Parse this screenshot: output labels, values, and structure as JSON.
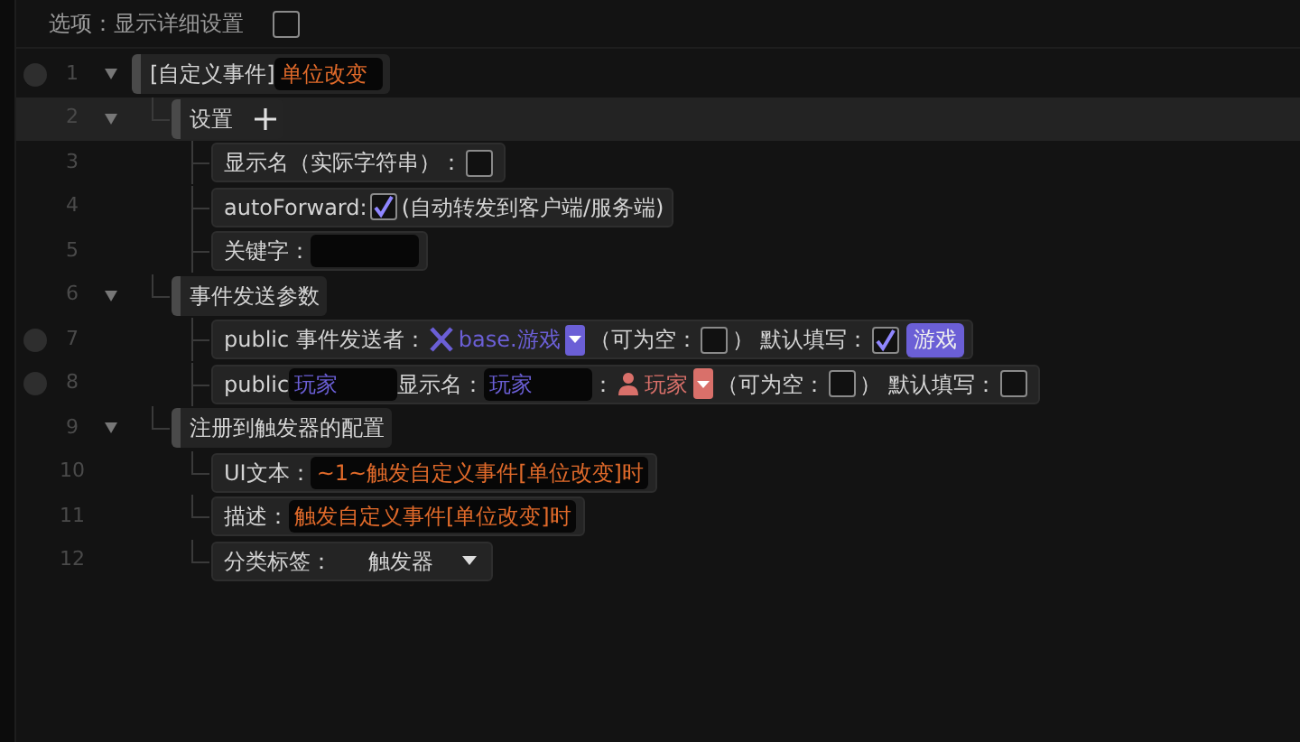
{
  "options": {
    "label": "选项：显示详细设置",
    "checked": false
  },
  "tree": [
    {
      "number": "1",
      "breakpoint": true,
      "expanded": true,
      "selected": false,
      "parts": [
        {
          "kind": "text",
          "text": "[自定义事件]"
        },
        {
          "kind": "field",
          "value": "单位改变",
          "color": "#e06a2a"
        }
      ],
      "children": [
        {
          "number": "2",
          "breakpoint": false,
          "expanded": true,
          "selected": true,
          "parts": [
            {
              "kind": "text",
              "text": "设置"
            },
            {
              "kind": "plus"
            }
          ],
          "children": [
            {
              "number": "3",
              "breakpoint": false,
              "selected": false,
              "parts": [
                {
                  "kind": "text",
                  "text": "显示名（实际字符串）："
                },
                {
                  "kind": "checkbox",
                  "checked": false
                }
              ]
            },
            {
              "number": "4",
              "breakpoint": false,
              "selected": false,
              "parts": [
                {
                  "kind": "text",
                  "text": "autoForward:"
                },
                {
                  "kind": "checkbox",
                  "checked": true
                },
                {
                  "kind": "text",
                  "text": "(自动转发到客户端/服务端)"
                }
              ]
            },
            {
              "number": "5",
              "breakpoint": false,
              "selected": false,
              "parts": [
                {
                  "kind": "text",
                  "text": "关键字："
                },
                {
                  "kind": "field"
                }
              ]
            }
          ]
        },
        {
          "number": "6",
          "breakpoint": false,
          "expanded": true,
          "selected": false,
          "parts": [
            {
              "kind": "text",
              "text": "事件发送参数"
            }
          ],
          "children": [
            {
              "number": "7",
              "breakpoint": true,
              "selected": false,
              "parts": [
                {
                  "kind": "text",
                  "text": "public 事件发送者："
                },
                {
                  "kind": "gametype",
                  "text": "base.游戏",
                  "color": "#6b5fd6"
                },
                {
                  "kind": "text",
                  "text": "（可为空："
                },
                {
                  "kind": "checkbox",
                  "checked": false
                },
                {
                  "kind": "text",
                  "text": "） 默认填写："
                },
                {
                  "kind": "checkbox",
                  "checked": true
                },
                {
                  "kind": "chip",
                  "text": "游戏",
                  "color": "#6b5fd6"
                }
              ]
            },
            {
              "number": "8",
              "breakpoint": true,
              "selected": false,
              "parts": [
                {
                  "kind": "text",
                  "text": "public"
                },
                {
                  "kind": "field",
                  "value": "玩家",
                  "color": "#6b5fd6"
                },
                {
                  "kind": "text",
                  "text": "显示名："
                },
                {
                  "kind": "field",
                  "value": "玩家",
                  "color": "#6b5fd6"
                },
                {
                  "kind": "text",
                  "text": "："
                },
                {
                  "kind": "playertype",
                  "text": "玩家",
                  "color": "#d9706a"
                },
                {
                  "kind": "text",
                  "text": "（可为空："
                },
                {
                  "kind": "checkbox",
                  "checked": false
                },
                {
                  "kind": "text",
                  "text": "） 默认填写："
                },
                {
                  "kind": "checkbox",
                  "checked": false
                }
              ]
            }
          ]
        },
        {
          "number": "9",
          "breakpoint": false,
          "expanded": true,
          "selected": false,
          "parts": [
            {
              "kind": "text",
              "text": "注册到触发器的配置"
            }
          ],
          "children": [
            {
              "number": "10",
              "breakpoint": false,
              "selected": false,
              "parts": [
                {
                  "kind": "text",
                  "text": "UI文本："
                },
                {
                  "kind": "field",
                  "value": "~1~触发自定义事件[单位改变]时",
                  "color": "#e06a2a"
                }
              ]
            },
            {
              "number": "11",
              "breakpoint": false,
              "selected": false,
              "parts": [
                {
                  "kind": "text",
                  "text": "描述："
                },
                {
                  "kind": "field",
                  "value": "触发自定义事件[单位改变]时",
                  "color": "#e06a2a"
                }
              ]
            },
            {
              "number": "12",
              "breakpoint": false,
              "selected": false,
              "parts": [
                {
                  "kind": "text",
                  "text": "分类标签："
                },
                {
                  "kind": "dropdown",
                  "value": "触发器"
                }
              ]
            }
          ]
        }
      ]
    }
  ]
}
